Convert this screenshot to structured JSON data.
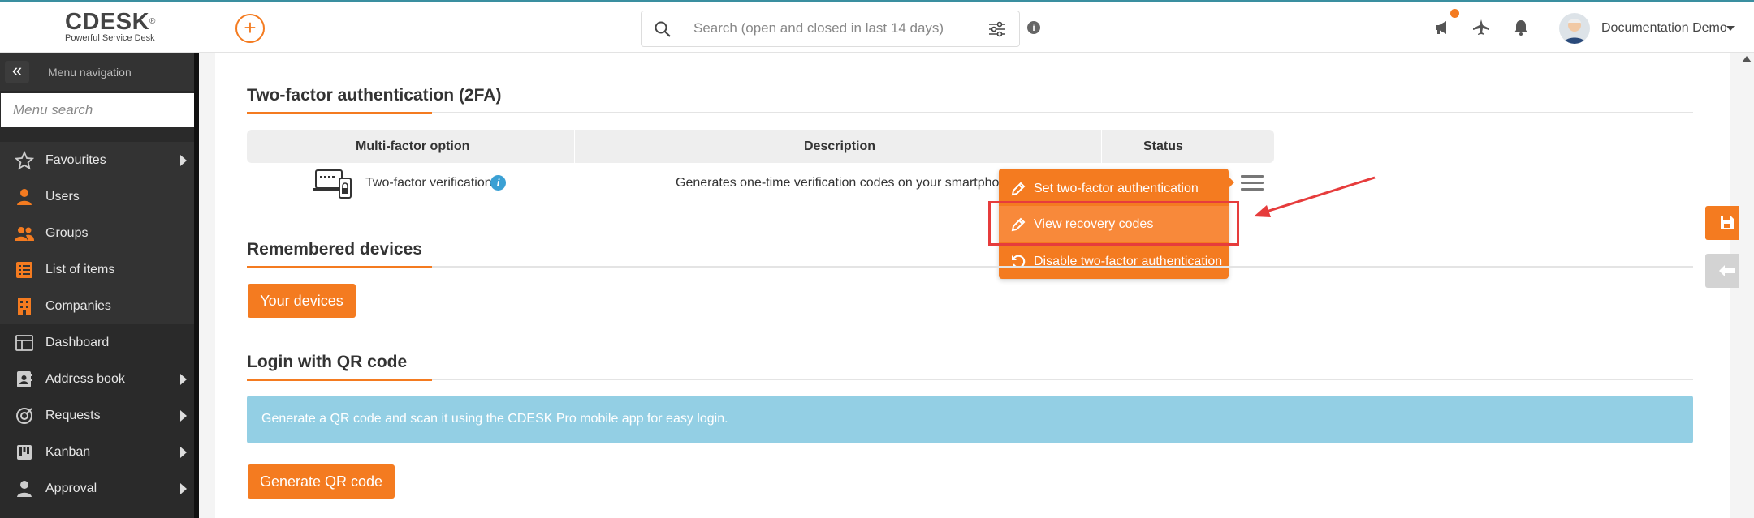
{
  "header": {
    "logo_brand": "CDESK",
    "logo_tagline": "Powerful Service Desk",
    "search_placeholder": "Search (open and closed in last 14 days)",
    "user_name": "Documentation Demo"
  },
  "sidebar": {
    "title": "Menu navigation",
    "search_placeholder": "Menu search",
    "items": [
      {
        "label": "Favourites",
        "icon": "star-icon",
        "has_submenu": true
      },
      {
        "label": "Users",
        "icon": "user-icon",
        "has_submenu": false
      },
      {
        "label": "Groups",
        "icon": "users-icon",
        "has_submenu": false
      },
      {
        "label": "List of items",
        "icon": "list-icon",
        "has_submenu": false
      },
      {
        "label": "Companies",
        "icon": "building-icon",
        "has_submenu": false
      },
      {
        "label": "Dashboard",
        "icon": "dashboard-icon",
        "has_submenu": false
      },
      {
        "label": "Address book",
        "icon": "address-book-icon",
        "has_submenu": true
      },
      {
        "label": "Requests",
        "icon": "requests-icon",
        "has_submenu": true
      },
      {
        "label": "Kanban",
        "icon": "kanban-icon",
        "has_submenu": true
      },
      {
        "label": "Approval",
        "icon": "approval-icon",
        "has_submenu": true
      }
    ]
  },
  "tfa": {
    "title": "Two-factor authentication (2FA)",
    "columns": [
      "Multi-factor option",
      "Description",
      "Status"
    ],
    "row": {
      "option": "Two-factor verification",
      "description": "Generates one-time verification codes on your smartphone."
    },
    "menu": [
      {
        "label": "Set two-factor authentication",
        "icon": "pencil-icon"
      },
      {
        "label": "View recovery codes",
        "icon": "pencil-icon"
      },
      {
        "label": "Disable two-factor authentication",
        "icon": "undo-icon"
      }
    ]
  },
  "devices": {
    "title": "Remembered devices",
    "button": "Your devices"
  },
  "qr": {
    "title": "Login with QR code",
    "info": "Generate a QR code and scan it using the CDESK Pro mobile app for easy login.",
    "button": "Generate QR code"
  },
  "colors": {
    "accent": "#f47b20",
    "sidebar_bg": "#2a2a2a",
    "info_bg": "#93cfe4",
    "highlight_box": "#e63c3c"
  }
}
